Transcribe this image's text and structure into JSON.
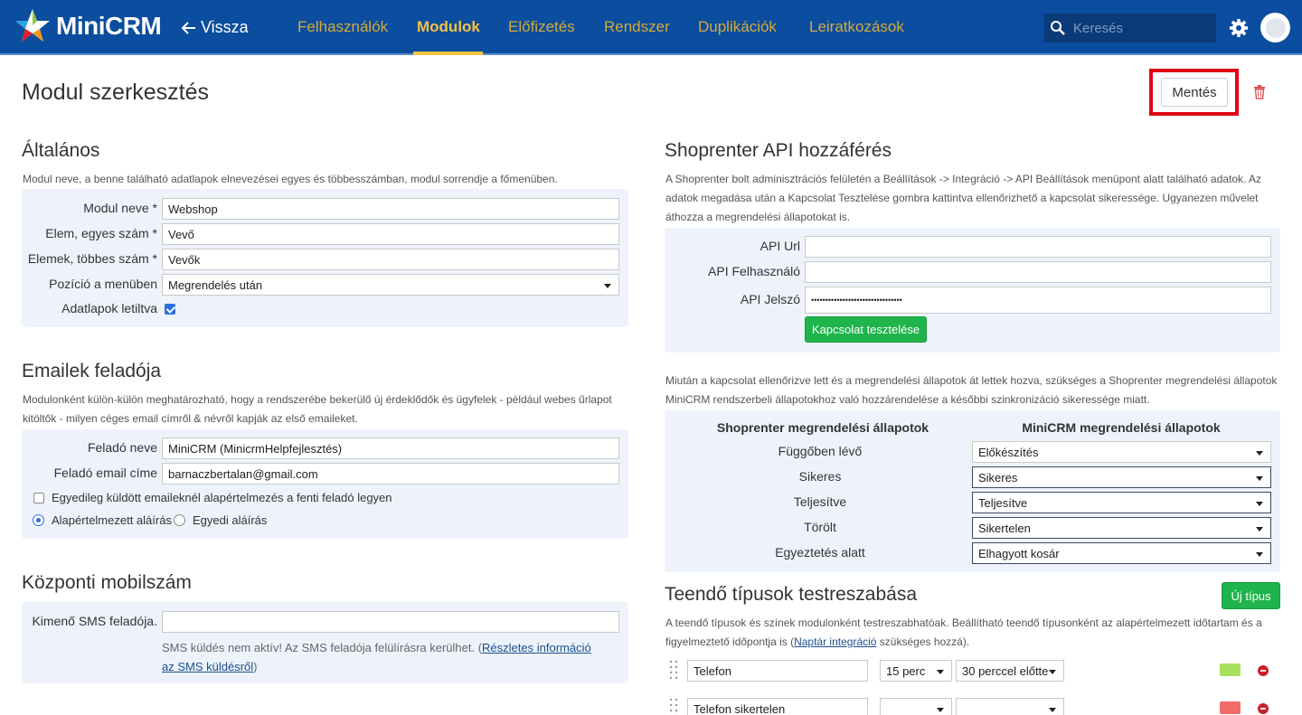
{
  "app": {
    "brand": "MiniCRM",
    "back_label": "Vissza",
    "nav": [
      "Felhasználók",
      "Modulok",
      "Előfizetés",
      "Rendszer",
      "Duplikációk",
      "Leiratkozások"
    ],
    "active_nav": "Modulok",
    "search_placeholder": "Keresés",
    "colors": {
      "topbar": "#0b4d9e",
      "accent": "#f6c344",
      "success": "#1fb44c",
      "danger": "#cc1e2c"
    }
  },
  "page": {
    "title": "Modul szerkesztés",
    "save_label": "Mentés"
  },
  "general": {
    "title": "Általános",
    "description": "Modul neve, a benne található adatlapok elnevezései egyes és többesszámban, modul sorrendje a főmenüben.",
    "module_name_label": "Modul neve *",
    "module_name_value": "Webshop",
    "singular_label": "Elem, egyes szám *",
    "singular_value": "Vevő",
    "plural_label": "Elemek, többes szám *",
    "plural_value": "Vevők",
    "position_label": "Pozíció a menüben",
    "position_value": "Megrendelés után",
    "disabled_label": "Adatlapok letiltva"
  },
  "email_sender": {
    "title": "Emailek feladója",
    "description_line1": "Modulonként külön-külön meghatározható, hogy a rendszerébe bekerülő új érdeklődők és ügyfelek - például webes űrlapot",
    "description_line2": "kitöltők - milyen céges email címről & névről kapják az első emaileket.",
    "sender_name_label": "Feladó neve",
    "sender_name_value": "MiniCRM (MinicrmHelpfejlesztés)",
    "sender_email_label": "Feladó email címe",
    "sender_email_value": "barnaczbertalan@gmail.com",
    "individual_default_label": "Egyedileg küldött emaileknél alapértelmezés a fenti feladó legyen",
    "default_signature_label": "Alapértelmezett aláírás",
    "custom_signature_label": "Egyedi aláírás"
  },
  "mobile": {
    "title": "Központi mobilszám",
    "sms_sender_label": "Kimenő SMS feladója.",
    "sms_sender_value": "",
    "note_prefix": "SMS küldés nem aktív!  Az SMS feladója felülírásra kerülhet. (",
    "note_link_line1": "Részletes információ",
    "note_link_line2": "az SMS küldésről",
    "note_suffix": ")"
  },
  "shoprenter": {
    "title": "Shoprenter API hozzáférés",
    "description_line1": "A Shoprenter bolt adminisztrációs felületén a Beállítások -> Integráció -> API Beállítások menüpont alatt található adatok. Az",
    "description_line2": "adatok megadása után a Kapcsolat Tesztelése gombra kattintva ellenőrizhető a kapcsolat sikeressége. Ugyanezen művelet",
    "description_line3": "áthozza a megrendelési állapotokat is.",
    "api_url_label": "API Url",
    "api_url_value": "",
    "api_user_label": "API Felhasználó",
    "api_user_value": "",
    "api_password_label": "API Jelszó",
    "api_password_value": "••••••••••••••••••••••••••••••••",
    "test_button_label": "Kapcsolat tesztelése"
  },
  "status_mapping": {
    "description_line1": "Miután a kapcsolat ellenőrizve lett és a megrendelési állapotok át lettek hozva, szükséges a Shoprenter megrendelési állapotok",
    "description_line2": "MiniCRM rendszerbeli állapotokhoz való hozzárendelése a későbbi szinkronizáció sikeressége miatt.",
    "col_shoprenter": "Shoprenter megrendelési állapotok",
    "col_minicrm": "MiniCRM megrendelési állapotok",
    "rows": [
      {
        "shoprenter": "Függőben lévő",
        "minicrm": "Előkészítés"
      },
      {
        "shoprenter": "Sikeres",
        "minicrm": "Sikeres"
      },
      {
        "shoprenter": "Teljesítve",
        "minicrm": "Teljesítve"
      },
      {
        "shoprenter": "Törölt",
        "minicrm": "Sikertelen"
      },
      {
        "shoprenter": "Egyeztetés alatt",
        "minicrm": "Elhagyott kosár"
      }
    ]
  },
  "task_types": {
    "title": "Teendő típusok testreszabása",
    "new_type_label": "Új típus",
    "description_line1": "A teendő típusok és színek modulonként testreszabhatóak. Beállítható teendő típusonként az alapértelmezett időtartam és a",
    "description_prefix": "figyelmeztető időpontja is (",
    "description_link": "Naptár integráció",
    "description_suffix": " szükséges hozzá).",
    "items": [
      {
        "name": "Telefon",
        "duration": "15 perc",
        "reminder": "30 perccel előtte",
        "color": "#a8e05f"
      },
      {
        "name": "Telefon sikertelen",
        "duration": "",
        "reminder": "",
        "color": "#f26b6b"
      }
    ]
  }
}
